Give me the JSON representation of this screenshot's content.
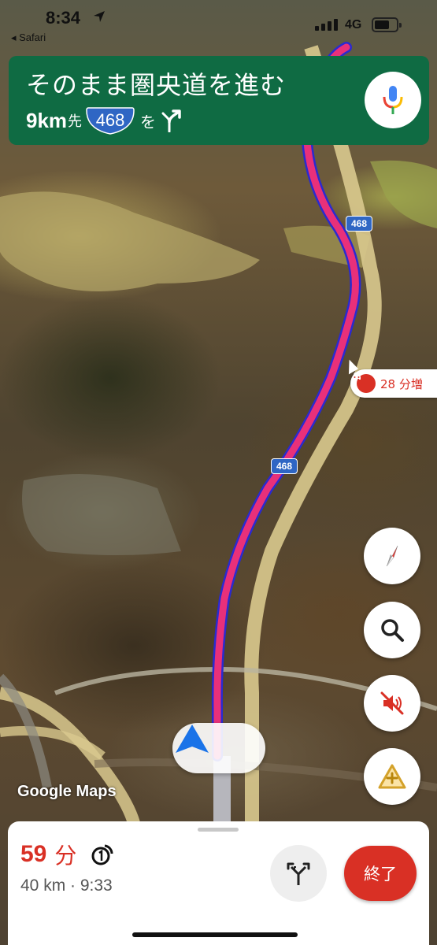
{
  "status_bar": {
    "time": "8:34",
    "back_app": "◂ Safari",
    "network": "4G"
  },
  "navigation": {
    "instruction": "そのまま圏央道を進む",
    "distance": "9km",
    "distance_suffix": "先",
    "route_shield": "468",
    "particle": "を",
    "turn_icon": "slight-right-fork-icon"
  },
  "map": {
    "route_shields": [
      "468",
      "468"
    ],
    "traffic_delay": "28 分増",
    "attribution": "Google Maps",
    "colors": {
      "route": "#e8307a",
      "route_outline": "#2a2ad0",
      "nav_green": "#0f6b43",
      "accent_red": "#d93025",
      "shield_blue": "#2f66c4"
    }
  },
  "controls": {
    "compass": "compass-icon",
    "search": "search-icon",
    "sound": "sound-off-icon",
    "report": "report-incident-icon"
  },
  "bottom_sheet": {
    "duration": "59",
    "duration_unit": "分",
    "trip_details": "40 km · 9:33",
    "exit_label": "終了"
  }
}
